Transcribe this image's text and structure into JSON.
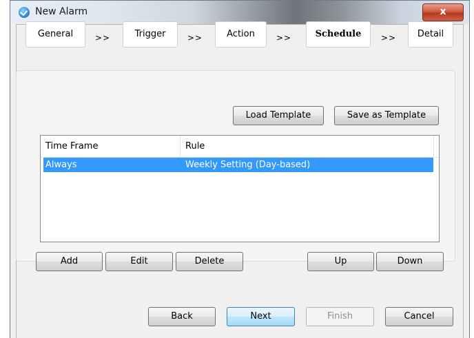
{
  "window": {
    "title": "New Alarm",
    "close_label": "x"
  },
  "steps": [
    {
      "label": "General",
      "active": false
    },
    {
      "label": "Trigger",
      "active": false
    },
    {
      "label": "Action",
      "active": false
    },
    {
      "label": "Schedule",
      "active": true
    },
    {
      "label": "Detail",
      "active": false
    }
  ],
  "step_separator": ">>",
  "template": {
    "load_label": "Load Template",
    "save_label": "Save as Template"
  },
  "table": {
    "columns": [
      "Time Frame",
      "Rule"
    ],
    "rows": [
      {
        "time_frame": "Always",
        "rule": "Weekly Setting (Day-based)",
        "selected": true
      }
    ]
  },
  "list_actions": {
    "add": "Add",
    "edit": "Edit",
    "delete": "Delete",
    "up": "Up",
    "down": "Down"
  },
  "footer": {
    "back": "Back",
    "next": "Next",
    "finish": "Finish",
    "cancel": "Cancel"
  },
  "colors": {
    "selection": "#3399ff",
    "primary_border": "#3c7fb1",
    "close_button": "#c8462c"
  }
}
